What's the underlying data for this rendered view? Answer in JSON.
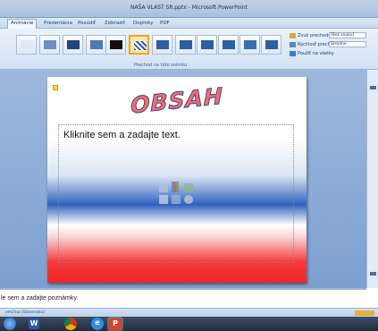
{
  "window": {
    "title": "NAŠA VLAST SR.pptx - Microsoft PowerPoint"
  },
  "tabs": [
    {
      "label": "Animácie",
      "active": true
    },
    {
      "label": "Prezentácia",
      "active": false
    },
    {
      "label": "Posúdiť",
      "active": false
    },
    {
      "label": "Zobraziť",
      "active": false
    },
    {
      "label": "Doplnky",
      "active": false
    },
    {
      "label": "PDF",
      "active": false
    }
  ],
  "ribbon": {
    "group_label": "Prechod na túto snímku",
    "transition_thumbnails": [
      {
        "name": "transition-none",
        "selected": false
      },
      {
        "name": "transition-fade-smooth",
        "selected": false
      },
      {
        "name": "transition-fade-black",
        "selected": false
      },
      {
        "name": "transition-cut",
        "selected": false
      },
      {
        "name": "transition-cut-black",
        "selected": false
      },
      {
        "name": "transition-dissolve",
        "selected": true
      },
      {
        "name": "transition-wipe-down",
        "selected": false
      },
      {
        "name": "transition-wipe-left",
        "selected": false
      },
      {
        "name": "transition-wipe-right",
        "selected": false
      },
      {
        "name": "transition-wipe-up",
        "selected": false
      },
      {
        "name": "transition-split",
        "selected": false
      },
      {
        "name": "transition-cover-down",
        "selected": false
      }
    ],
    "sound_label": "Zvuk prechodu:",
    "sound_value": "[Bez zvuku]",
    "speed_label": "Rýchlosť prechodu:",
    "speed_value": "Stredne",
    "apply_all_label": "Použiť na všetky"
  },
  "slide": {
    "title": "OBSAH",
    "content_placeholder": "Kliknite sem a zadajte text."
  },
  "notes": {
    "placeholder": "le sem a zadajte poznámky."
  },
  "status": {
    "language": "emčina (Slovensko)"
  },
  "colors": {
    "title_fill": "#ff6a6a",
    "title_outline": "#2e4a8c",
    "slide_blue": "#2f63be",
    "slide_red": "#f02626",
    "workspace_blue": "#7d9fd0"
  }
}
